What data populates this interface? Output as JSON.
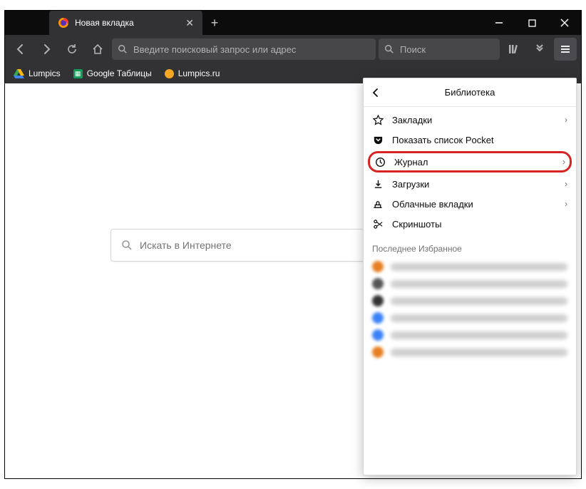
{
  "tab": {
    "title": "Новая вкладка"
  },
  "urlbar": {
    "placeholder": "Введите поисковый запрос или адрес"
  },
  "searchbar": {
    "placeholder": "Поиск"
  },
  "bookmarks": [
    {
      "label": "Lumpics",
      "icon": "drive",
      "color1": "#e94335",
      "color2": "#34a853",
      "color3": "#fbbc05"
    },
    {
      "label": "Google Таблицы",
      "icon": "sheets"
    },
    {
      "label": "Lumpics.ru",
      "icon": "dot",
      "color": "#f5a623"
    }
  ],
  "centerSearch": {
    "placeholder": "Искать в Интернете"
  },
  "panel": {
    "title": "Библиотека",
    "items": [
      {
        "icon": "star",
        "label": "Закладки",
        "chevron": true,
        "name": "bookmarks"
      },
      {
        "icon": "pocket",
        "label": "Показать список Pocket",
        "chevron": false,
        "name": "pocket"
      },
      {
        "icon": "clock",
        "label": "Журнал",
        "chevron": true,
        "name": "history",
        "highlight": true
      },
      {
        "icon": "download",
        "label": "Загрузки",
        "chevron": true,
        "name": "downloads"
      },
      {
        "icon": "cloud",
        "label": "Облачные вкладки",
        "chevron": true,
        "name": "synced-tabs"
      },
      {
        "icon": "scissors",
        "label": "Скриншоты",
        "chevron": false,
        "name": "screenshots"
      }
    ],
    "recentTitle": "Последнее Избранное",
    "recent": [
      {
        "color": "#e67e22"
      },
      {
        "color": "#555"
      },
      {
        "color": "#333"
      },
      {
        "color": "#3b82f6"
      },
      {
        "color": "#3b82f6"
      },
      {
        "color": "#e67e22"
      }
    ]
  }
}
